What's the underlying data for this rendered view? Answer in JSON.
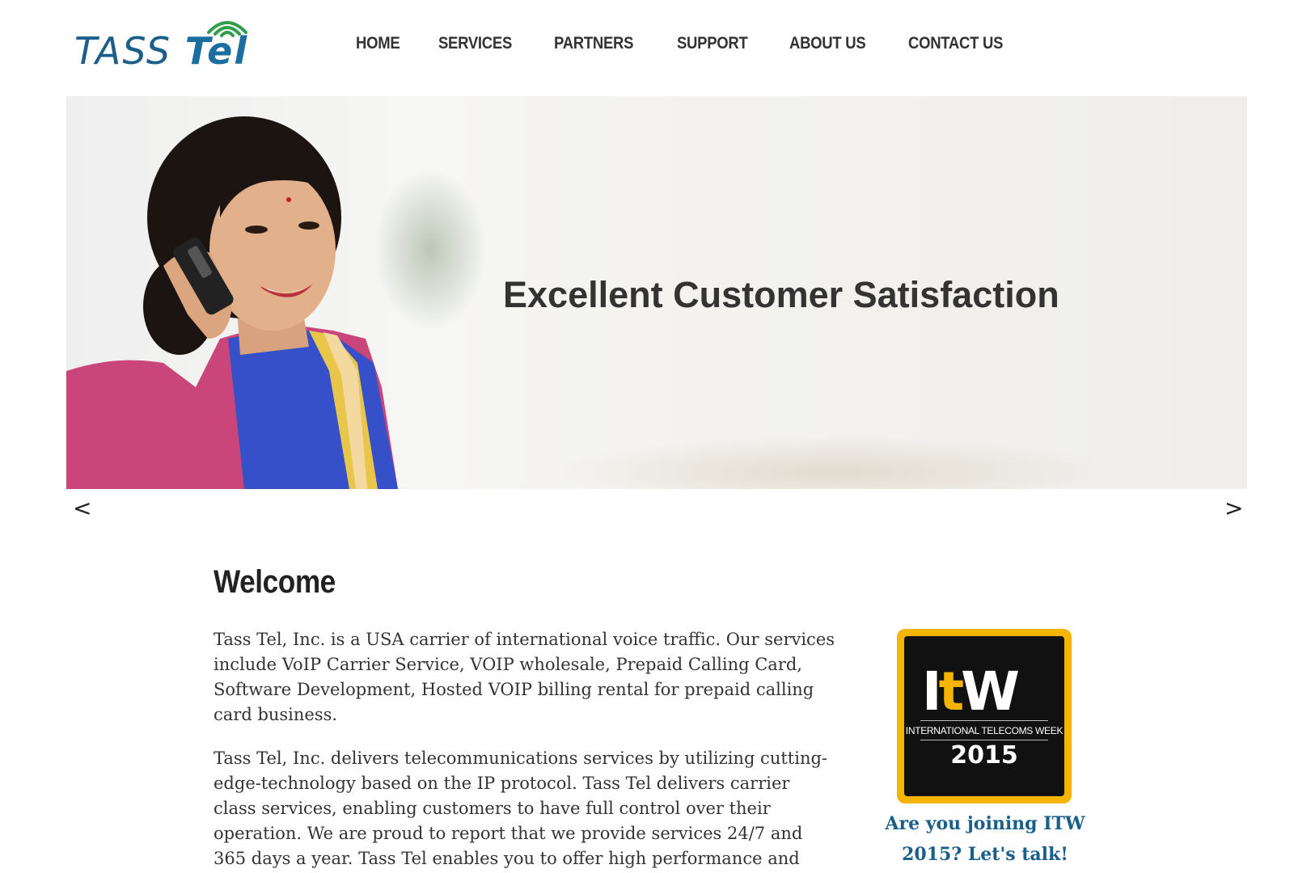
{
  "header": {
    "logo": {
      "text_main": "TASS ",
      "text_accent": "Tel"
    },
    "nav": [
      {
        "label": "HOME"
      },
      {
        "label": "SERVICES"
      },
      {
        "label": "PARTNERS"
      },
      {
        "label": "SUPPORT"
      },
      {
        "label": "ABOUT US"
      },
      {
        "label": "CONTACT US"
      }
    ]
  },
  "hero": {
    "caption": "Excellent Customer Satisfaction",
    "prev": "<",
    "next": ">"
  },
  "content": {
    "title": "Welcome",
    "paragraphs": [
      "Tass Tel, Inc. is a USA carrier of international voice traffic. Our services include VoIP Carrier Service, VOIP wholesale, Prepaid Calling Card, Software Development, Hosted VOIP billing rental for prepaid calling card business.",
      "Tass Tel, Inc. delivers telecommunications services by utilizing cutting-edge-technology based on the IP protocol. Tass Tel delivers carrier class services, enabling customers to have full control over their operation. We are proud to report that we provide services 24/7 and 365 days a year. Tass Tel enables you to offer high performance and reliable global"
    ]
  },
  "sidebar": {
    "badge": {
      "logo_pre": "I",
      "logo_t": "t",
      "logo_post": "W",
      "subtitle": "INTERNATIONAL TELECOMS WEEK",
      "year": "2015"
    },
    "cta": "Are you joining ITW 2015? Let's talk!"
  },
  "colors": {
    "brand_blue": "#1a5e8a",
    "wifi_green": "#2e9e4a",
    "badge_gold": "#f5b400"
  }
}
